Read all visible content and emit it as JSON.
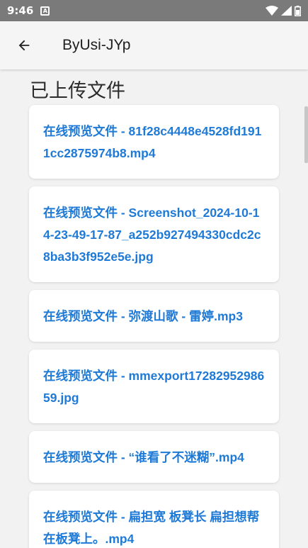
{
  "status_bar": {
    "time": "9:46",
    "notification_glyph": "A",
    "icons": [
      "wifi-icon",
      "signal-icon",
      "battery-icon"
    ]
  },
  "app_bar": {
    "title": "ByUsi-JYp",
    "back_icon": "arrow-left-icon"
  },
  "section": {
    "title": "已上传文件"
  },
  "files": [
    {
      "label": "在线预览文件 - 81f28c4448e4528fd1911cc2875974b8.mp4"
    },
    {
      "label": "在线预览文件 - Screenshot_2024-10-14-23-49-17-87_a252b927494330cdc2c8ba3b3f952e5e.jpg"
    },
    {
      "label": "在线预览文件 - 弥渡山歌 - 雷婷.mp3"
    },
    {
      "label": "在线预览文件 - mmexport1728295298659.jpg"
    },
    {
      "label": "在线预览文件 - “谁看了不迷糊”.mp4"
    },
    {
      "label": "在线预览文件 - 扁担宽 板凳长 扁担想帮在板凳上。.mp4"
    }
  ],
  "colors": {
    "link": "#1e7ad6",
    "status_bar": "#7a7a7a",
    "background": "#f2f2f2"
  }
}
